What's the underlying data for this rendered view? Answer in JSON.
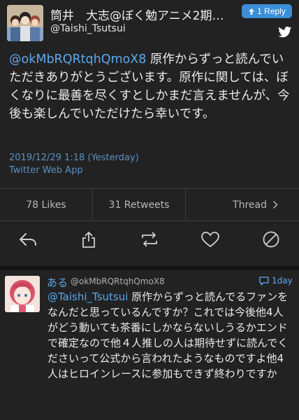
{
  "tweet": {
    "display_name": "筒井　大志@ぼく勉アニメ2期…",
    "handle": "@Taishi_Tsutsui",
    "reply_button_label": "1 Reply",
    "body_mention": "@okMbRQRtqhQmoX8",
    "body_text": " 原作からずっと読んでいただきありがとうございます。原作に関しては、ぼくなりに最善を尽くすとしかまだ言えませんが、今後も楽しんでいただけたら幸いです。",
    "timestamp": "2019/12/29 1:18 (Yesterday)",
    "source": "Twitter Web App",
    "likes": "78 Likes",
    "retweets": "31 Retweets",
    "thread_label": "Thread",
    "icons": [
      "reply-icon",
      "share-icon",
      "retweet-icon",
      "like-icon",
      "block-icon"
    ]
  },
  "reply": {
    "name": "ある",
    "handle": "@okMbRQRtqhQmoX8",
    "time": "1day",
    "body_mention": "@Taishi_Tsutsui",
    "body_text": " 原作からずっと読んでるファンをなんだと思っているんですか？これでは今後他4人がどう動いても茶番にしかならないしうるかエンドで確定なので他４人推しの人は期待せずに読んでくださいって公式から言われたようなものですよ他4人はヒロインレースに参加もできず終わりですか"
  },
  "colors": {
    "background": "#222222",
    "link": "#5ea8ee",
    "reply_button": "#3a8fd9"
  }
}
